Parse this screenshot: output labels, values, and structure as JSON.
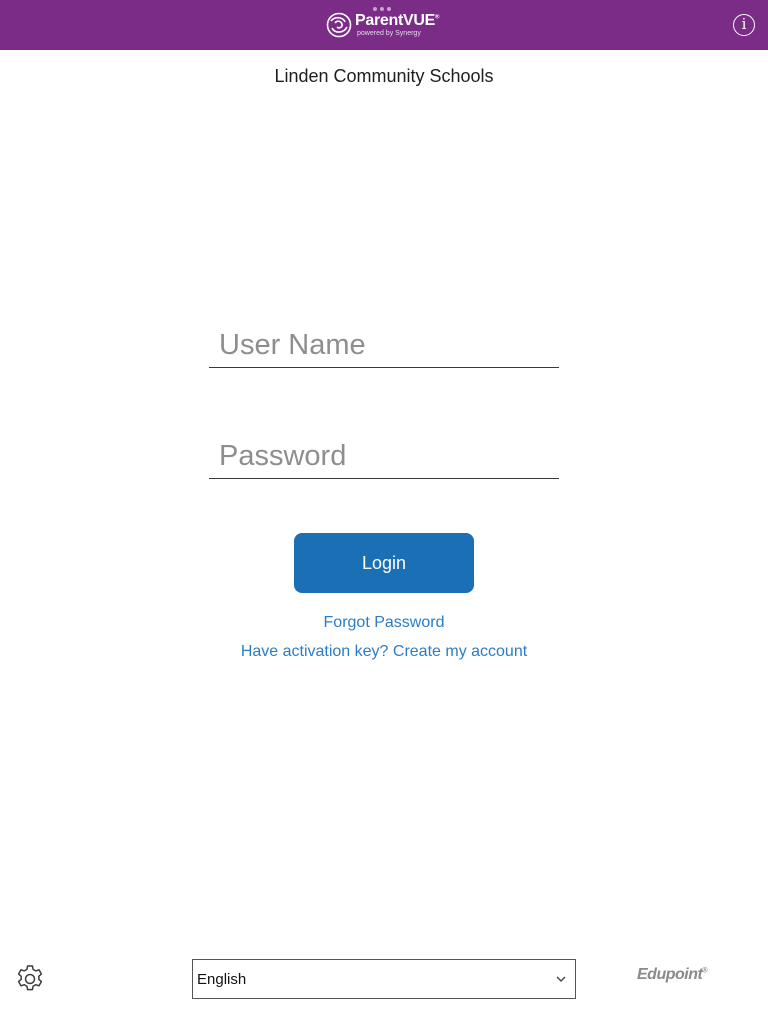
{
  "header": {
    "app_name": "ParentVUE",
    "app_name_mark": "®",
    "tagline": "powered by Synergy",
    "logo_icon": "parentvue-logo-icon",
    "info_icon": "info-icon",
    "bar_color": "#7a2c86"
  },
  "district": {
    "name": "Linden Community Schools"
  },
  "login_form": {
    "username_placeholder": "User Name",
    "username_value": "",
    "password_placeholder": "Password",
    "password_value": "",
    "login_label": "Login",
    "login_color": "#1a6fb5"
  },
  "links": {
    "forgot_password": "Forgot Password",
    "create_account": "Have activation key? Create my account",
    "link_color": "#2a7dc6"
  },
  "footer": {
    "settings_icon": "gear-icon",
    "language_selected": "English",
    "language_dropdown_icon": "chevron-down-icon",
    "brand": "Edupoint",
    "brand_mark": "®"
  }
}
